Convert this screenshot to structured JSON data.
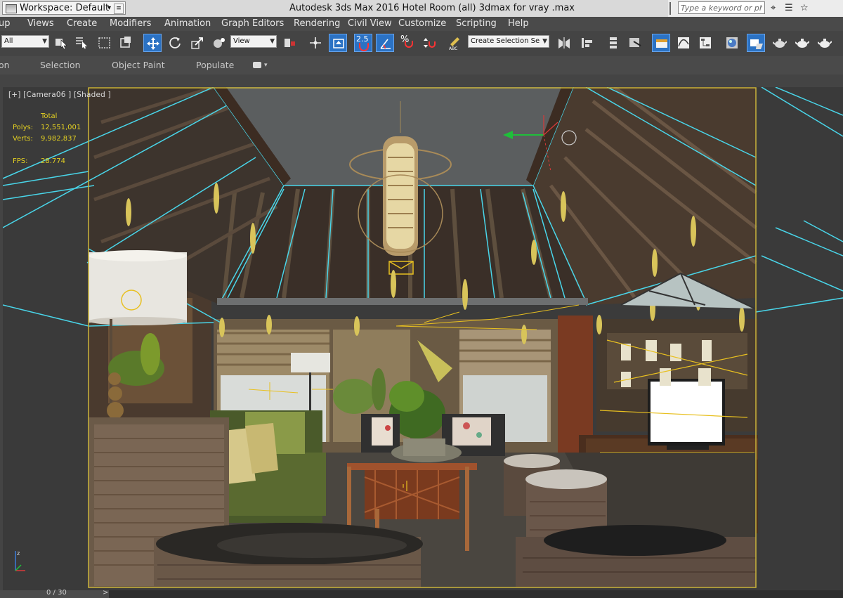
{
  "titlebar": {
    "workspace_label": "Workspace: Default",
    "title": "Autodesk 3ds Max 2016     Hotel Room  (all) 3dmax for vray .max",
    "search_placeholder": "Type a keyword or phrase"
  },
  "menu": {
    "items": [
      "up",
      "Views",
      "Create",
      "Modifiers",
      "Animation",
      "Graph Editors",
      "Rendering",
      "Civil View",
      "Customize",
      "Scripting",
      "Help"
    ]
  },
  "toolbar": {
    "filter_value": "All",
    "ref_coord_value": "View",
    "named_selection_placeholder": "Create Selection Se",
    "snap_label": "2.5",
    "percent_snap_label": "%"
  },
  "ribbon": {
    "tabs": [
      "on",
      "Selection",
      "Object Paint",
      "Populate"
    ]
  },
  "viewport": {
    "label": "[+] [Camera06 ] [Shaded ]",
    "stats": {
      "header": "Total",
      "polys_label": "Polys:",
      "polys_value": "12,551,001",
      "verts_label": "Verts:",
      "verts_value": "9,982,837",
      "fps_label": "FPS:",
      "fps_value": "28.774"
    }
  },
  "timeline": {
    "frame_label": "0 / 30",
    "next_symbol": ">"
  },
  "colors": {
    "accent": "#2b72c4",
    "wire": "#49d6ea",
    "stats_text": "#e2cf22",
    "safe_frame": "#c9b33a"
  }
}
